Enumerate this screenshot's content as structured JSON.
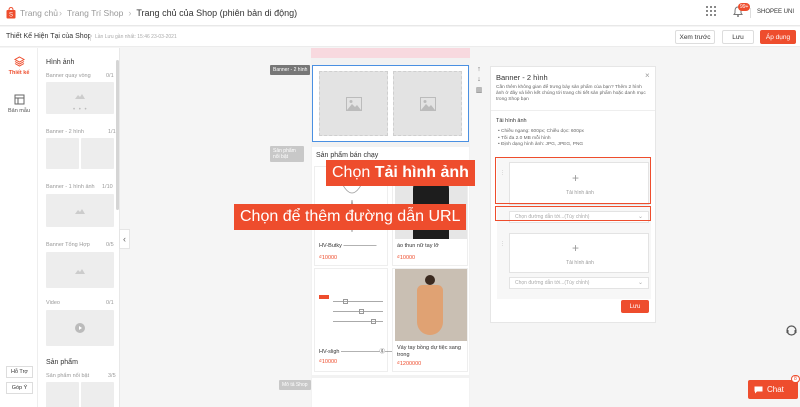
{
  "topbar": {
    "logo": "Trang chủ",
    "crumbs": [
      "Trang Trí Shop",
      "Trang chủ của Shop (phiên bản di động)"
    ],
    "notify_badge": "99+",
    "user": "SHOPEE UNI"
  },
  "subbar": {
    "title": "Thiết Kế Hiện Tại của Shop",
    "saved": "Lần Lưu gần nhất: 15:46 23-03-2021",
    "preview": "Xem trước",
    "save": "Lưu",
    "apply": "Áp dụng"
  },
  "rail": {
    "design": "Thiết kế",
    "template": "Bản mẫu",
    "help": "Hỗ Trợ",
    "feedback": "Góp Ý"
  },
  "panel": {
    "section_image": "Hình ảnh",
    "banner_carousel": "Banner quay vòng",
    "banner_carousel_count": "0/1",
    "banner_2": "Banner - 2 hình",
    "banner_2_count": "1/1",
    "banner_1": "Banner - 1 hình ảnh",
    "banner_1_count": "1/10",
    "banner_mix": "Banner Tổng Hợp",
    "banner_mix_count": "0/5",
    "video": "Video",
    "video_count": "0/1",
    "section_product": "Sản phẩm",
    "featured": "Sản phẩm nổi bật",
    "featured_count": "3/5"
  },
  "canvas": {
    "banner_tag": "Banner - 2 hình",
    "featured_tag": "Sản phẩm nổi bật",
    "featured_title": "Sản phẩm bán chạy",
    "shop_tag": "Mô tả Shop",
    "products": [
      {
        "name": "HV-Butky ——————",
        "price": "₫10000"
      },
      {
        "name": "áo thun nữ tay lỡ",
        "price": "₫10000"
      },
      {
        "name": "HV-sligh ———————ⓖ————",
        "price": "₫10000"
      },
      {
        "name": "Váy tay bồng dự tiệc sang trong",
        "price": "₫1200000"
      }
    ]
  },
  "editor": {
    "title": "Banner - 2 hình",
    "desc": "Cần thêm không gian để trưng bày sản phẩm của bạn? Thêm 2 hình ảnh ở đây và liên kết chúng tới trang chi tiết sản phẩm hoặc danh mục trong Shop bạn",
    "upload_heading": "Tải hình ảnh",
    "specs": [
      "Chiều ngang: 600px; Chiều dọc: 600px",
      "Tối đa 2.0 MB mỗi hình",
      "Định dạng hình ảnh: JPG, JPEG, PNG"
    ],
    "upload_label": "Tải hình ảnh",
    "link_placeholder": "Chọn đường dẫn tới...(Tùy chỉnh)",
    "upload_label_2": "Tải hình ảnh",
    "link_placeholder_2": "Chọn đường dẫn tới...(Tùy chỉnh)",
    "save": "Lưu"
  },
  "callouts": {
    "upload": "Chọn Tải hình ảnh",
    "upload_prefix": "Chọn ",
    "upload_bold": "Tải hình ảnh",
    "link": "Chọn để thêm đường dẫn URL"
  },
  "chat": {
    "label": "Chat",
    "badge": "8"
  },
  "colors": {
    "brand": "#ee4d2d",
    "selection": "#4a90e2"
  }
}
